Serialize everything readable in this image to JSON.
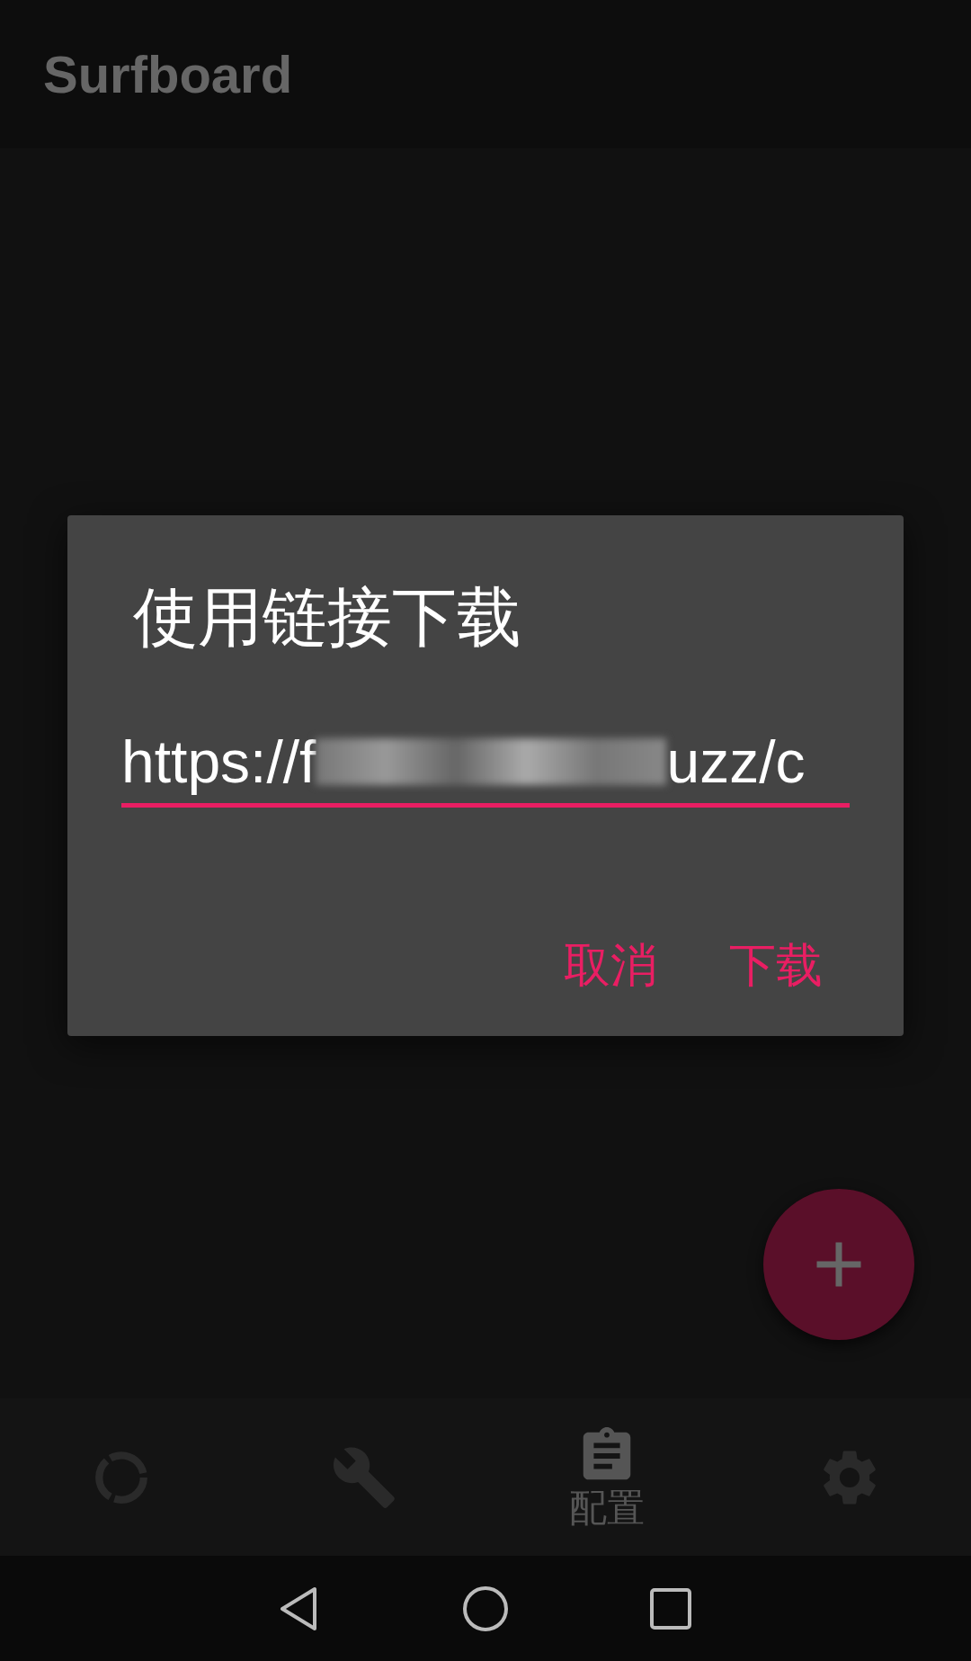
{
  "app_bar": {
    "title": "Surfboard"
  },
  "dialog": {
    "title": "使用链接下载",
    "url_field": {
      "value_prefix": "https://f",
      "value_suffix": "uzz/c",
      "redacted": true
    },
    "buttons": [
      {
        "label": "取消"
      },
      {
        "label": "下载"
      }
    ]
  },
  "bottom_nav": [
    {
      "kind": "status",
      "selected": false
    },
    {
      "kind": "tools",
      "selected": false
    },
    {
      "kind": "profiles",
      "label": "配置",
      "selected": true
    },
    {
      "kind": "settings",
      "selected": false
    }
  ]
}
